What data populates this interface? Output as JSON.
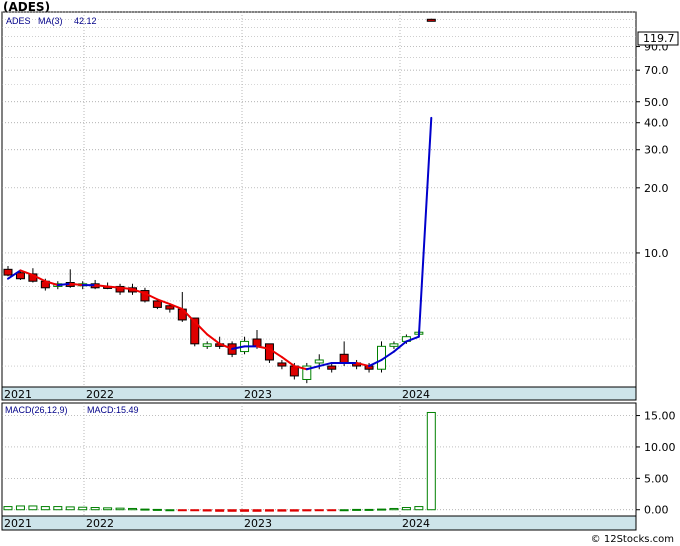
{
  "title": "(ADES)",
  "legend": {
    "ticker": "ADES",
    "ma_label": "MA(3)",
    "ma_value": "42.12"
  },
  "last_price_badge": "119.7",
  "macd_legend": {
    "label": "MACD(26,12,9)",
    "value_label": "MACD:15.49"
  },
  "footer": "© 12Stocks.com",
  "x_labels": [
    "2021",
    "2022",
    "2023",
    "2024"
  ],
  "colors": {
    "up": "#008000",
    "down": "#dd0000",
    "ma_down": "#ee0000",
    "ma_up": "#0000cc",
    "axis_band": "#cde4ea"
  },
  "chart_data": [
    {
      "type": "candlestick",
      "scale": "log",
      "ylim": [
        2.4,
        130
      ],
      "y_ticks": [
        10,
        20,
        30,
        40,
        50,
        70,
        90
      ],
      "y_tick_labels": [
        "10.0",
        "20.0",
        "30.0",
        "40.0",
        "50.0",
        "70.0",
        "90.0"
      ],
      "candles": [
        {
          "t": 0,
          "o": 8.4,
          "h": 8.7,
          "l": 7.8,
          "c": 7.9
        },
        {
          "t": 1,
          "o": 8.1,
          "h": 8.2,
          "l": 7.5,
          "c": 7.6
        },
        {
          "t": 2,
          "o": 8.0,
          "h": 8.5,
          "l": 7.3,
          "c": 7.4
        },
        {
          "t": 3,
          "o": 7.4,
          "h": 7.6,
          "l": 6.7,
          "c": 6.9
        },
        {
          "t": 4,
          "o": 7.0,
          "h": 7.4,
          "l": 6.8,
          "c": 7.2
        },
        {
          "t": 5,
          "o": 7.3,
          "h": 8.4,
          "l": 6.9,
          "c": 7.0
        },
        {
          "t": 6,
          "o": 7.1,
          "h": 7.4,
          "l": 6.8,
          "c": 7.2
        },
        {
          "t": 7,
          "o": 7.2,
          "h": 7.5,
          "l": 6.8,
          "c": 6.9
        },
        {
          "t": 8,
          "o": 7.0,
          "h": 7.3,
          "l": 6.8,
          "c": 6.9
        },
        {
          "t": 9,
          "o": 7.0,
          "h": 7.2,
          "l": 6.4,
          "c": 6.6
        },
        {
          "t": 10,
          "o": 6.9,
          "h": 7.2,
          "l": 6.4,
          "c": 6.6
        },
        {
          "t": 11,
          "o": 6.7,
          "h": 6.9,
          "l": 5.9,
          "c": 6.0
        },
        {
          "t": 12,
          "o": 6.0,
          "h": 6.1,
          "l": 5.5,
          "c": 5.6
        },
        {
          "t": 13,
          "o": 5.7,
          "h": 5.8,
          "l": 5.3,
          "c": 5.5
        },
        {
          "t": 14,
          "o": 5.5,
          "h": 6.6,
          "l": 4.8,
          "c": 4.9
        },
        {
          "t": 15,
          "o": 5.0,
          "h": 5.0,
          "l": 3.7,
          "c": 3.8
        },
        {
          "t": 16,
          "o": 3.7,
          "h": 3.9,
          "l": 3.6,
          "c": 3.8
        },
        {
          "t": 17,
          "o": 3.8,
          "h": 4.1,
          "l": 3.6,
          "c": 3.7
        },
        {
          "t": 18,
          "o": 3.8,
          "h": 3.9,
          "l": 3.3,
          "c": 3.4
        },
        {
          "t": 19,
          "o": 3.5,
          "h": 4.1,
          "l": 3.4,
          "c": 3.9
        },
        {
          "t": 20,
          "o": 4.0,
          "h": 4.4,
          "l": 3.6,
          "c": 3.7
        },
        {
          "t": 21,
          "o": 3.8,
          "h": 3.8,
          "l": 3.1,
          "c": 3.2
        },
        {
          "t": 22,
          "o": 3.1,
          "h": 3.2,
          "l": 2.9,
          "c": 3.0
        },
        {
          "t": 23,
          "o": 3.0,
          "h": 3.1,
          "l": 2.6,
          "c": 2.7
        },
        {
          "t": 24,
          "o": 2.6,
          "h": 3.1,
          "l": 2.5,
          "c": 3.0
        },
        {
          "t": 25,
          "o": 3.1,
          "h": 3.4,
          "l": 2.9,
          "c": 3.2
        },
        {
          "t": 26,
          "o": 3.0,
          "h": 3.1,
          "l": 2.8,
          "c": 2.9
        },
        {
          "t": 27,
          "o": 3.4,
          "h": 3.9,
          "l": 3.0,
          "c": 3.1
        },
        {
          "t": 28,
          "o": 3.1,
          "h": 3.2,
          "l": 2.9,
          "c": 3.0
        },
        {
          "t": 29,
          "o": 3.0,
          "h": 3.1,
          "l": 2.8,
          "c": 2.9
        },
        {
          "t": 30,
          "o": 2.9,
          "h": 3.9,
          "l": 2.8,
          "c": 3.7
        },
        {
          "t": 31,
          "o": 3.7,
          "h": 3.9,
          "l": 3.6,
          "c": 3.8
        },
        {
          "t": 32,
          "o": 3.9,
          "h": 4.2,
          "l": 3.8,
          "c": 4.1
        },
        {
          "t": 33,
          "o": 4.3,
          "h": 4.4,
          "l": 4.2,
          "c": 4.3
        },
        {
          "t": 34,
          "o": 120.3,
          "h": 121.0,
          "l": 118.7,
          "c": 119.7
        }
      ],
      "ma3": [
        7.6,
        8.3,
        7.9,
        7.4,
        7.1,
        7.2,
        7.1,
        7.1,
        7.0,
        6.9,
        6.8,
        6.5,
        6.1,
        5.8,
        5.5,
        4.8,
        4.2,
        3.8,
        3.6,
        3.7,
        3.7,
        3.6,
        3.3,
        3.0,
        2.9,
        3.0,
        3.1,
        3.1,
        3.1,
        3.0,
        3.2,
        3.5,
        3.9,
        4.1,
        42.12
      ]
    },
    {
      "type": "bar",
      "label": "MACD(26,12,9)",
      "ylim": [
        -1,
        17
      ],
      "y_ticks": [
        0,
        5,
        10,
        15
      ],
      "y_tick_labels": [
        "0.00",
        "5.00",
        "10.00",
        "15.00"
      ],
      "values": [
        0.5,
        0.6,
        0.6,
        0.5,
        0.5,
        0.45,
        0.4,
        0.35,
        0.3,
        0.25,
        0.2,
        0.1,
        0.05,
        0.0,
        -0.05,
        -0.15,
        -0.2,
        -0.25,
        -0.25,
        -0.25,
        -0.25,
        -0.22,
        -0.22,
        -0.22,
        -0.18,
        -0.1,
        -0.05,
        0.0,
        0.05,
        0.05,
        0.1,
        0.2,
        0.35,
        0.5,
        15.49
      ]
    }
  ]
}
